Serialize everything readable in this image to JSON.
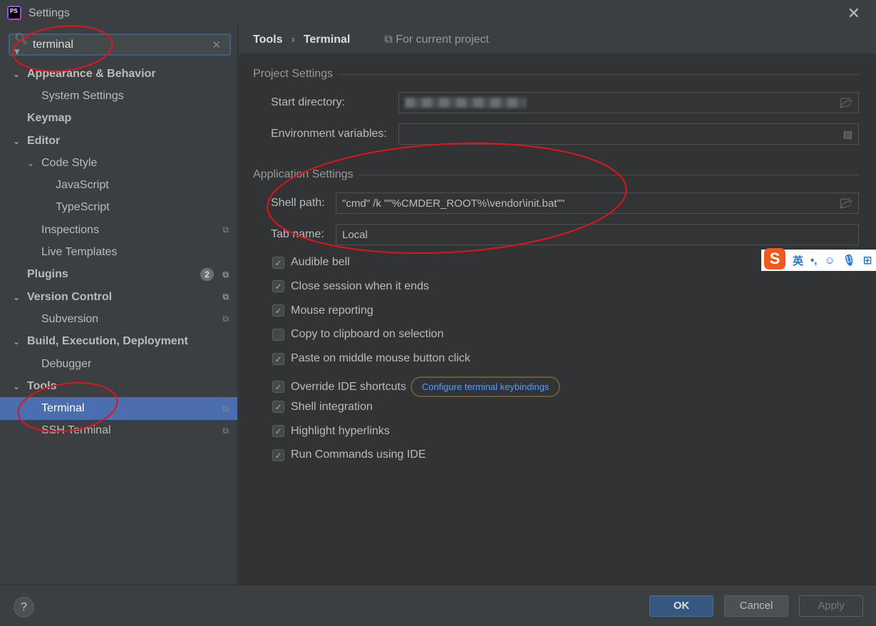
{
  "window": {
    "title": "Settings",
    "logo": "PS"
  },
  "search": {
    "value": "terminal"
  },
  "tree": [
    {
      "label": "Appearance & Behavior",
      "level": 0,
      "bold": true,
      "expanded": true
    },
    {
      "label": "System Settings",
      "level": 1
    },
    {
      "label": "Keymap",
      "level": 0,
      "bold": true
    },
    {
      "label": "Editor",
      "level": 0,
      "bold": true,
      "expanded": true
    },
    {
      "label": "Code Style",
      "level": 1,
      "expanded": true
    },
    {
      "label": "JavaScript",
      "level": 2
    },
    {
      "label": "TypeScript",
      "level": 2
    },
    {
      "label": "Inspections",
      "level": 1,
      "copy": true
    },
    {
      "label": "Live Templates",
      "level": 1
    },
    {
      "label": "Plugins",
      "level": 0,
      "bold": true,
      "badge": "2",
      "copy": true
    },
    {
      "label": "Version Control",
      "level": 0,
      "bold": true,
      "expanded": true,
      "copy": true
    },
    {
      "label": "Subversion",
      "level": 1,
      "copy": true
    },
    {
      "label": "Build, Execution, Deployment",
      "level": 0,
      "bold": true,
      "expanded": true
    },
    {
      "label": "Debugger",
      "level": 1
    },
    {
      "label": "Tools",
      "level": 0,
      "bold": true,
      "expanded": true
    },
    {
      "label": "Terminal",
      "level": 1,
      "selected": true,
      "copy": true
    },
    {
      "label": "SSH Terminal",
      "level": 1,
      "copy": true
    }
  ],
  "breadcrumb": {
    "parent": "Tools",
    "current": "Terminal",
    "scope": "For current project"
  },
  "project": {
    "title": "Project Settings",
    "start_dir_label": "Start directory:",
    "env_label": "Environment variables:"
  },
  "app": {
    "title": "Application Settings",
    "shell_label": "Shell path:",
    "shell_value": "\"cmd\" /k \"\"%CMDER_ROOT%\\vendor\\init.bat\"\"",
    "tab_label": "Tab name:",
    "tab_value": "Local"
  },
  "checkboxes": [
    {
      "label": "Audible bell",
      "checked": true
    },
    {
      "label": "Close session when it ends",
      "checked": true
    },
    {
      "label": "Mouse reporting",
      "checked": true
    },
    {
      "label": "Copy to clipboard on selection",
      "checked": false
    },
    {
      "label": "Paste on middle mouse button click",
      "checked": true
    },
    {
      "label": "Override IDE shortcuts",
      "checked": true
    },
    {
      "label": "Shell integration",
      "checked": true
    },
    {
      "label": "Highlight hyperlinks",
      "checked": true
    },
    {
      "label": "Run Commands using IDE",
      "checked": true
    }
  ],
  "keybindings_link": "Configure terminal keybindings",
  "buttons": {
    "help": "?",
    "ok": "OK",
    "cancel": "Cancel",
    "apply": "Apply"
  },
  "ime": {
    "logo": "S",
    "mode": "英",
    "punct": "•,"
  },
  "colors": {
    "selection": "#4b6eaf",
    "link": "#589df6",
    "annotation": "#e0141e"
  }
}
